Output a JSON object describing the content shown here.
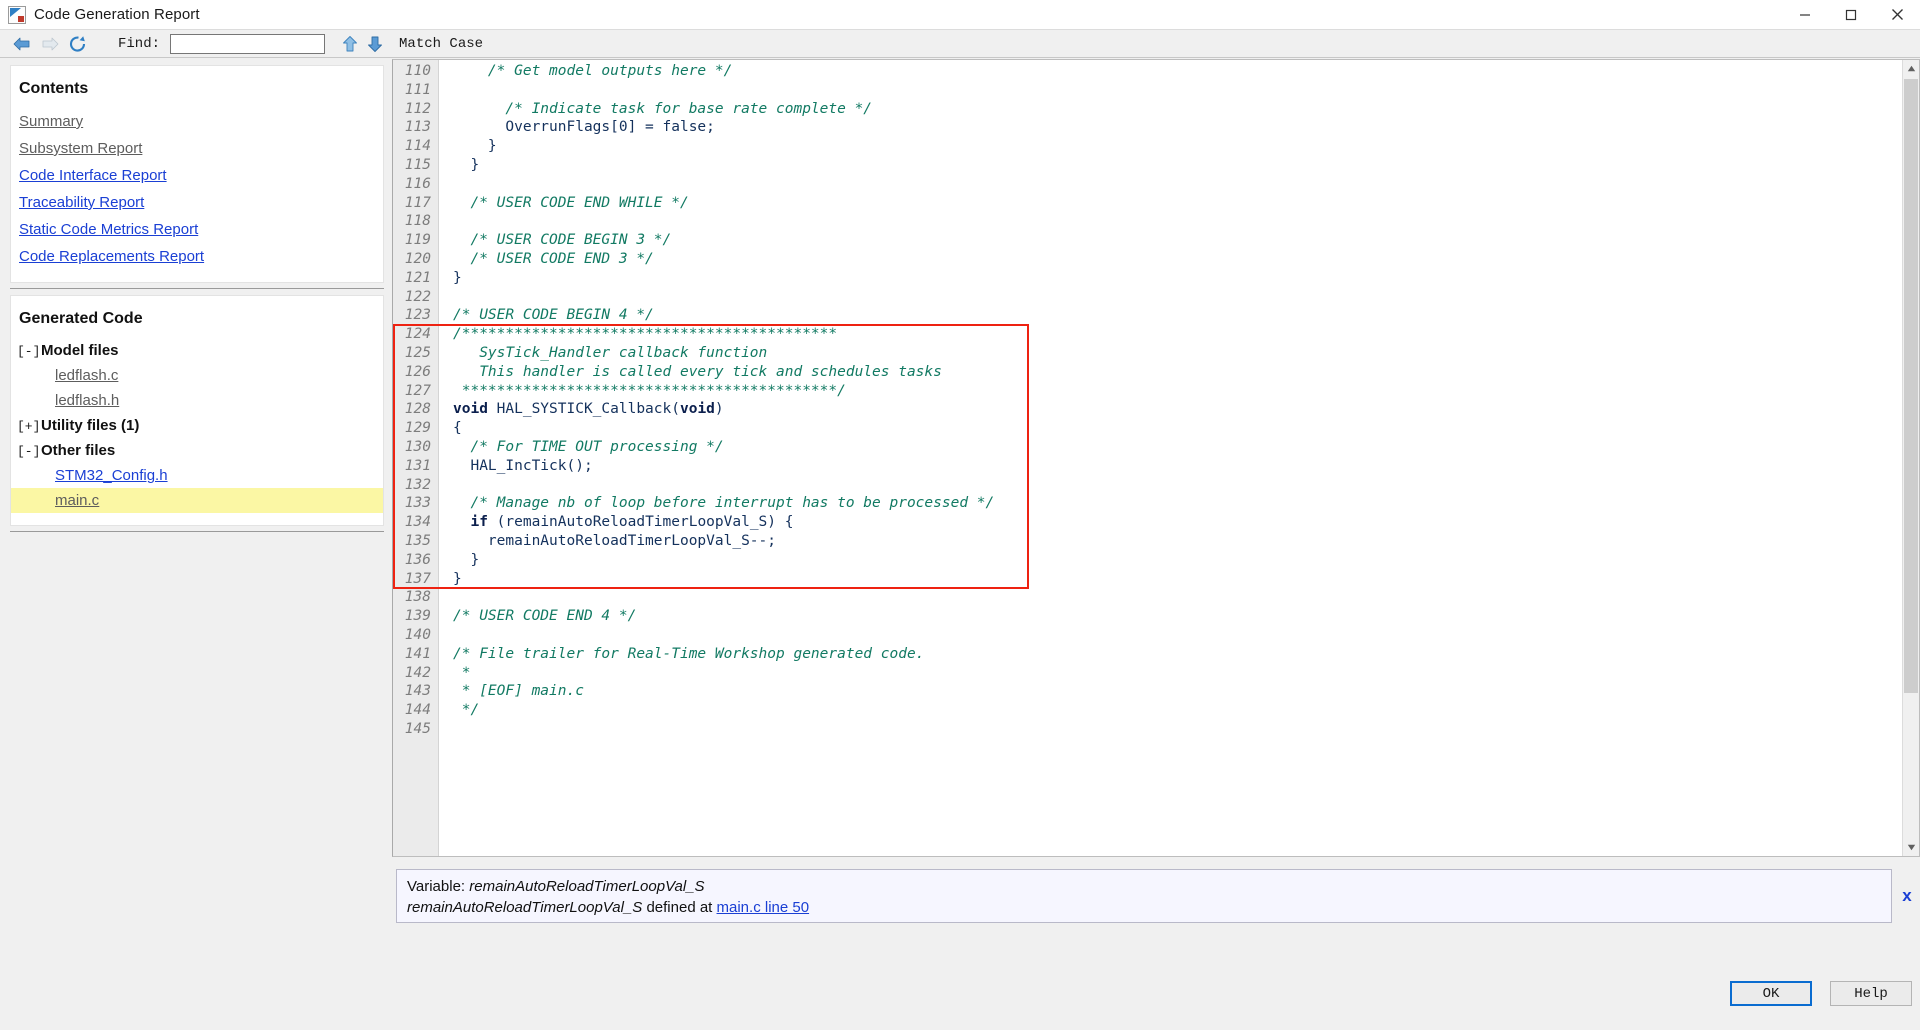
{
  "window": {
    "title": "Code Generation Report",
    "app_icon": "report-icon",
    "controls": [
      {
        "name": "minimize",
        "glyph": "minimize-icon"
      },
      {
        "name": "maximize",
        "glyph": "maximize-icon"
      },
      {
        "name": "close",
        "glyph": "close-icon"
      }
    ]
  },
  "toolbar": {
    "back_icon": "back-arrow-icon",
    "forward_icon": "forward-arrow-icon",
    "refresh_icon": "refresh-icon",
    "find_label": "Find:",
    "find_value": "",
    "find_placeholder": "",
    "up_icon": "find-previous-icon",
    "down_icon": "find-next-icon",
    "match_case_label": "Match Case"
  },
  "sidebar": {
    "contents_title": "Contents",
    "contents_links": [
      {
        "label": "Summary",
        "state": "visited"
      },
      {
        "label": "Subsystem Report",
        "state": "visited"
      },
      {
        "label": "Code Interface Report",
        "state": "unvisited"
      },
      {
        "label": "Traceability Report",
        "state": "unvisited"
      },
      {
        "label": "Static Code Metrics Report",
        "state": "unvisited"
      },
      {
        "label": "Code Replacements Report",
        "state": "unvisited"
      }
    ],
    "generated_code_title": "Generated Code",
    "groups": [
      {
        "toggle": "[-]",
        "expanded": true,
        "label": "Model files",
        "files": [
          {
            "label": "ledflash.c",
            "state": "visited",
            "current": false
          },
          {
            "label": "ledflash.h",
            "state": "visited",
            "current": false
          }
        ]
      },
      {
        "toggle": "[+]",
        "expanded": false,
        "label": "Utility files (1)",
        "files": []
      },
      {
        "toggle": "[-]",
        "expanded": true,
        "label": "Other files",
        "files": [
          {
            "label": "STM32_Config.h",
            "state": "unvisited",
            "current": false
          },
          {
            "label": "main.c",
            "state": "visited",
            "current": true
          }
        ]
      }
    ]
  },
  "code": {
    "highlight_color": "#ee2211",
    "comment_color": "#127a63",
    "keyword_color": "#0b1f4d",
    "code_color": "#14315c",
    "highlight_start_line": 124,
    "highlight_end_line": 137,
    "lines": [
      {
        "n": "110",
        "parts": [
          {
            "t": "    /* Get model outputs here */",
            "c": "cm"
          }
        ]
      },
      {
        "n": "111",
        "parts": [
          {
            "t": "",
            "c": ""
          }
        ]
      },
      {
        "n": "112",
        "parts": [
          {
            "t": "      /* Indicate task for base rate complete */",
            "c": "cm"
          }
        ]
      },
      {
        "n": "113",
        "parts": [
          {
            "t": "      OverrunFlags[0] = false;",
            "c": ""
          }
        ]
      },
      {
        "n": "114",
        "parts": [
          {
            "t": "    }",
            "c": ""
          }
        ]
      },
      {
        "n": "115",
        "parts": [
          {
            "t": "  }",
            "c": ""
          }
        ]
      },
      {
        "n": "116",
        "parts": [
          {
            "t": "",
            "c": ""
          }
        ]
      },
      {
        "n": "117",
        "parts": [
          {
            "t": "  /* USER CODE END WHILE */",
            "c": "cm"
          }
        ]
      },
      {
        "n": "118",
        "parts": [
          {
            "t": "",
            "c": ""
          }
        ]
      },
      {
        "n": "119",
        "parts": [
          {
            "t": "  /* USER CODE BEGIN 3 */",
            "c": "cm"
          }
        ]
      },
      {
        "n": "120",
        "parts": [
          {
            "t": "  /* USER CODE END 3 */",
            "c": "cm"
          }
        ]
      },
      {
        "n": "121",
        "parts": [
          {
            "t": "}",
            "c": ""
          }
        ]
      },
      {
        "n": "122",
        "parts": [
          {
            "t": "",
            "c": ""
          }
        ]
      },
      {
        "n": "123",
        "parts": [
          {
            "t": "/* USER CODE BEGIN 4 */",
            "c": "cm"
          }
        ]
      },
      {
        "n": "124",
        "parts": [
          {
            "t": "/*******************************************",
            "c": "cm"
          }
        ]
      },
      {
        "n": "125",
        "parts": [
          {
            "t": "   SysTick_Handler callback function",
            "c": "cm"
          }
        ]
      },
      {
        "n": "126",
        "parts": [
          {
            "t": "   This handler is called every tick and schedules tasks",
            "c": "cm"
          }
        ]
      },
      {
        "n": "127",
        "parts": [
          {
            "t": " *******************************************/",
            "c": "cm"
          }
        ]
      },
      {
        "n": "128",
        "parts": [
          {
            "t": "void",
            "c": "kw"
          },
          {
            "t": " HAL_SYSTICK_Callback(",
            "c": ""
          },
          {
            "t": "void",
            "c": "kw"
          },
          {
            "t": ")",
            "c": ""
          }
        ]
      },
      {
        "n": "129",
        "parts": [
          {
            "t": "{",
            "c": ""
          }
        ]
      },
      {
        "n": "130",
        "parts": [
          {
            "t": "  /* For TIME OUT processing */",
            "c": "cm"
          }
        ]
      },
      {
        "n": "131",
        "parts": [
          {
            "t": "  HAL_IncTick();",
            "c": ""
          }
        ]
      },
      {
        "n": "132",
        "parts": [
          {
            "t": "",
            "c": ""
          }
        ]
      },
      {
        "n": "133",
        "parts": [
          {
            "t": "  /* Manage nb of loop before interrupt has to be processed */",
            "c": "cm"
          }
        ]
      },
      {
        "n": "134",
        "parts": [
          {
            "t": "  ",
            "c": ""
          },
          {
            "t": "if",
            "c": "kw"
          },
          {
            "t": " (remainAutoReloadTimerLoopVal_S) {",
            "c": ""
          }
        ]
      },
      {
        "n": "135",
        "parts": [
          {
            "t": "    remainAutoReloadTimerLoopVal_S--;",
            "c": ""
          }
        ]
      },
      {
        "n": "136",
        "parts": [
          {
            "t": "  }",
            "c": ""
          }
        ]
      },
      {
        "n": "137",
        "parts": [
          {
            "t": "}",
            "c": ""
          }
        ]
      },
      {
        "n": "138",
        "parts": [
          {
            "t": "",
            "c": ""
          }
        ]
      },
      {
        "n": "139",
        "parts": [
          {
            "t": "/* USER CODE END 4 */",
            "c": "cm"
          }
        ]
      },
      {
        "n": "140",
        "parts": [
          {
            "t": "",
            "c": ""
          }
        ]
      },
      {
        "n": "141",
        "parts": [
          {
            "t": "/* File trailer for Real-Time Workshop generated code.",
            "c": "cm"
          }
        ]
      },
      {
        "n": "142",
        "parts": [
          {
            "t": " *",
            "c": "cm"
          }
        ]
      },
      {
        "n": "143",
        "parts": [
          {
            "t": " * [EOF] main.c",
            "c": "cm"
          }
        ]
      },
      {
        "n": "144",
        "parts": [
          {
            "t": " */",
            "c": "cm"
          }
        ]
      },
      {
        "n": "145",
        "parts": [
          {
            "t": "",
            "c": ""
          }
        ]
      }
    ]
  },
  "tooltip": {
    "line1_prefix": "Variable: ",
    "line1_variable": "remainAutoReloadTimerLoopVal_S",
    "line2_variable": "remainAutoReloadTimerLoopVal_S",
    "line2_middle": " defined at ",
    "line2_link": "main.c line 50",
    "close_label": "x"
  },
  "footer": {
    "ok_label": "OK",
    "help_label": "Help"
  }
}
